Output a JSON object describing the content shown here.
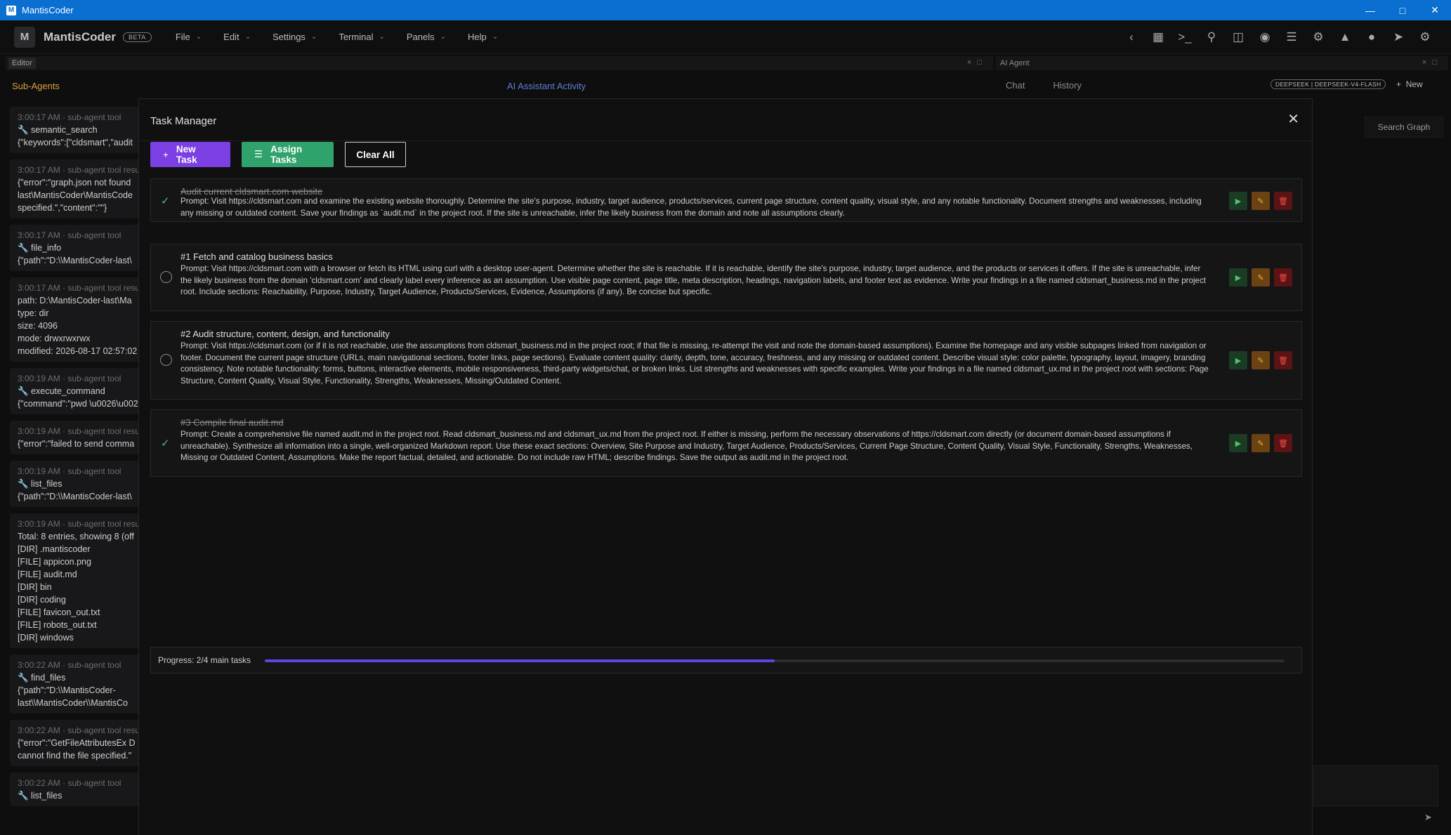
{
  "window": {
    "title": "MantisCoder",
    "app_glyph": "M"
  },
  "menubar": {
    "logo_letter": "M",
    "brand": "MantisCoder",
    "badge": "BETA",
    "menus": [
      "File",
      "Edit",
      "Settings",
      "Terminal",
      "Panels",
      "Help"
    ]
  },
  "editor": {
    "tab_label": "Editor",
    "subagents_title": "Sub-Agents",
    "activity_title": "AI Assistant Activity",
    "log": [
      {
        "meta": "3:00:17 AM · sub-agent tool",
        "lines": [
          "🔧 semantic_search",
          "{\"keywords\":[\"cldsmart\",\"audit"
        ]
      },
      {
        "meta": "3:00:17 AM · sub-agent tool resu",
        "lines": [
          "{\"error\":\"graph.json not found",
          "last\\MantisCoder\\MantisCode",
          "specified.\",\"content\":\"\"}"
        ]
      },
      {
        "meta": "3:00:17 AM · sub-agent tool",
        "lines": [
          "🔧 file_info",
          "{\"path\":\"D:\\\\MantisCoder-last\\"
        ]
      },
      {
        "meta": "3:00:17 AM · sub-agent tool resu",
        "lines": [
          "path: D:\\MantisCoder-last\\Ma",
          "type: dir",
          "size: 4096",
          "mode: drwxrwxrwx",
          "modified: 2026-08-17 02:57:02"
        ]
      },
      {
        "meta": "3:00:19 AM · sub-agent tool",
        "lines": [
          "🔧 execute_command",
          "{\"command\":\"pwd \\u0026\\u0026"
        ]
      },
      {
        "meta": "3:00:19 AM · sub-agent tool resu",
        "lines": [
          "{\"error\":\"failed to send comma"
        ]
      },
      {
        "meta": "3:00:19 AM · sub-agent tool",
        "lines": [
          "🔧 list_files",
          "{\"path\":\"D:\\\\MantisCoder-last\\"
        ]
      },
      {
        "meta": "3:00:19 AM · sub-agent tool resu",
        "lines": [
          "Total: 8 entries, showing 8 (off",
          "[DIR]  .mantiscoder",
          "[FILE] appicon.png",
          "[FILE] audit.md",
          "[DIR]  bin",
          "[DIR]  coding",
          "[FILE] favicon_out.txt",
          "[FILE] robots_out.txt",
          "[DIR]  windows"
        ]
      },
      {
        "meta": "3:00:22 AM · sub-agent tool",
        "lines": [
          "🔧 find_files",
          "{\"path\":\"D:\\\\MantisCoder-",
          "last\\\\MantisCoder\\\\MantisCo"
        ]
      },
      {
        "meta": "3:00:22 AM · sub-agent tool resu",
        "lines": [
          "{\"error\":\"GetFileAttributesEx D",
          "cannot find the file specified.\""
        ]
      },
      {
        "meta": "3:00:22 AM · sub-agent tool",
        "lines": [
          "🔧 list_files"
        ]
      }
    ]
  },
  "agent": {
    "panel_label": "AI Agent",
    "tabs": [
      "Chat",
      "History"
    ],
    "model": "DEEPSEEK | DEEPSEEK-V4-FLASH",
    "new_label": "New",
    "search_graph": "Search Graph"
  },
  "task_manager": {
    "title": "Task Manager",
    "buttons": {
      "new_task": "New Task",
      "assign_tasks": "Assign Tasks",
      "clear_all": "Clear All"
    },
    "tasks": [
      {
        "title": "Audit current cldsmart.com website",
        "done": true,
        "prompt": "Prompt: Visit https://cldsmart.com and examine the existing website thoroughly. Determine the site's purpose, industry, target audience, products/services, current page structure, content quality, visual style, and any notable functionality. Document strengths and weaknesses, including any missing or outdated content. Save your findings as `audit.md` in the project root. If the site is unreachable, infer the likely business from the domain and note all assumptions clearly."
      },
      {
        "title": "#1 Fetch and catalog business basics",
        "done": false,
        "prompt": "Prompt: Visit https://cldsmart.com with a browser or fetch its HTML using curl with a desktop user-agent. Determine whether the site is reachable. If it is reachable, identify the site's purpose, industry, target audience, and the products or services it offers. If the site is unreachable, infer the likely business from the domain 'cldsmart.com' and clearly label every inference as an assumption. Use visible page content, page title, meta description, headings, navigation labels, and footer text as evidence. Write your findings in a file named cldsmart_business.md in the project root. Include sections: Reachability, Purpose, Industry, Target Audience, Products/Services, Evidence, Assumptions (if any). Be concise but specific."
      },
      {
        "title": "#2 Audit structure, content, design, and functionality",
        "done": false,
        "prompt": "Prompt: Visit https://cldsmart.com (or if it is not reachable, use the assumptions from cldsmart_business.md in the project root; if that file is missing, re-attempt the visit and note the domain-based assumptions). Examine the homepage and any visible subpages linked from navigation or footer. Document the current page structure (URLs, main navigational sections, footer links, page sections). Evaluate content quality: clarity, depth, tone, accuracy, freshness, and any missing or outdated content. Describe visual style: color palette, typography, layout, imagery, branding consistency. Note notable functionality: forms, buttons, interactive elements, mobile responsiveness, third-party widgets/chat, or broken links. List strengths and weaknesses with specific examples. Write your findings in a file named cldsmart_ux.md in the project root with sections: Page Structure, Content Quality, Visual Style, Functionality, Strengths, Weaknesses, Missing/Outdated Content."
      },
      {
        "title": "#3 Compile final audit.md",
        "done": true,
        "prompt": "Prompt: Create a comprehensive file named audit.md in the project root. Read cldsmart_business.md and cldsmart_ux.md from the project root. If either is missing, perform the necessary observations of https://cldsmart.com directly (or document domain-based assumptions if unreachable). Synthesize all information into a single, well-organized Markdown report. Use these exact sections: Overview, Site Purpose and Industry, Target Audience, Products/Services, Current Page Structure, Content Quality, Visual Style, Functionality, Strengths, Weaknesses, Missing or Outdated Content, Assumptions. Make the report factual, detailed, and actionable. Do not include raw HTML; describe findings. Save the output as audit.md in the project root."
      }
    ],
    "progress": {
      "label": "Progress: 2/4 main tasks",
      "fraction": 0.5
    }
  },
  "colors": {
    "titlebar": "#0a6fd1",
    "accent_purple": "#7b3fe4",
    "accent_green": "#2fa36b",
    "subagents_orange": "#d8a03e",
    "activity_blue": "#5b7fd4",
    "done_check": "#45c36b"
  },
  "icons": {
    "toolbar": [
      "chevron-left-icon",
      "calendar-icon",
      "terminal-icon",
      "search-icon",
      "split-panel-icon",
      "eye-icon",
      "checklist-icon",
      "bug-icon",
      "flask-icon",
      "robot-icon",
      "rocket-icon",
      "gear-icon"
    ]
  }
}
